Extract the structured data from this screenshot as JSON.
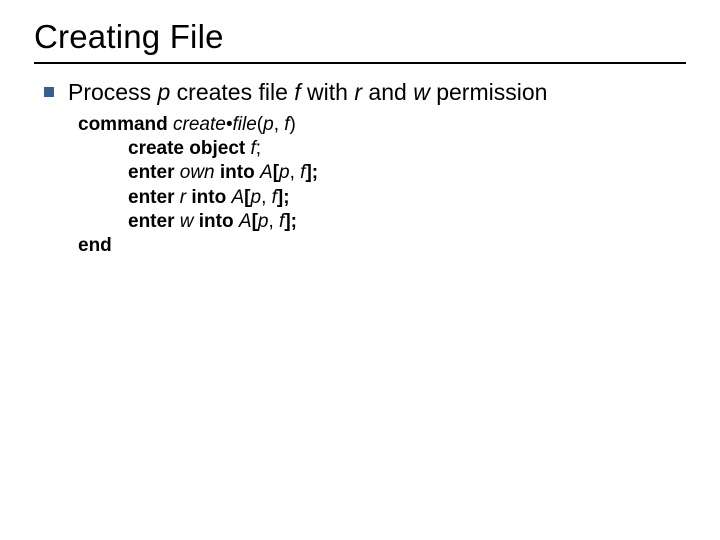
{
  "title": "Creating File",
  "bullet": {
    "t1": "Process ",
    "p": "p",
    "t2": " creates file ",
    "f": "f",
    "t3": " with ",
    "r": "r",
    "t4": " and ",
    "w": "w",
    "t5": " permission"
  },
  "code": {
    "l1": {
      "kw": "command",
      "fn": " create•file",
      "args_open": "(",
      "a1": "p",
      "sep": ", ",
      "a2": "f",
      "args_close": ")"
    },
    "l2": {
      "kw": "create object ",
      "v": "f",
      "sc": ";"
    },
    "l3": {
      "kw1": "enter ",
      "v1": "own",
      "kw2": " into ",
      "arr": "A",
      "br1": "[",
      "a1": "p",
      "sep": ", ",
      "a2": "f",
      "br2": "];"
    },
    "l4": {
      "kw1": "enter ",
      "v1": "r",
      "kw2": " into ",
      "arr": "A",
      "br1": "[",
      "a1": "p",
      "sep": ", ",
      "a2": "f",
      "br2": "];"
    },
    "l5": {
      "kw1": "enter ",
      "v1": "w",
      "kw2": " into ",
      "arr": "A",
      "br1": "[",
      "a1": "p",
      "sep": ", ",
      "a2": "f",
      "br2": "];"
    },
    "l6": {
      "kw": "end"
    }
  }
}
